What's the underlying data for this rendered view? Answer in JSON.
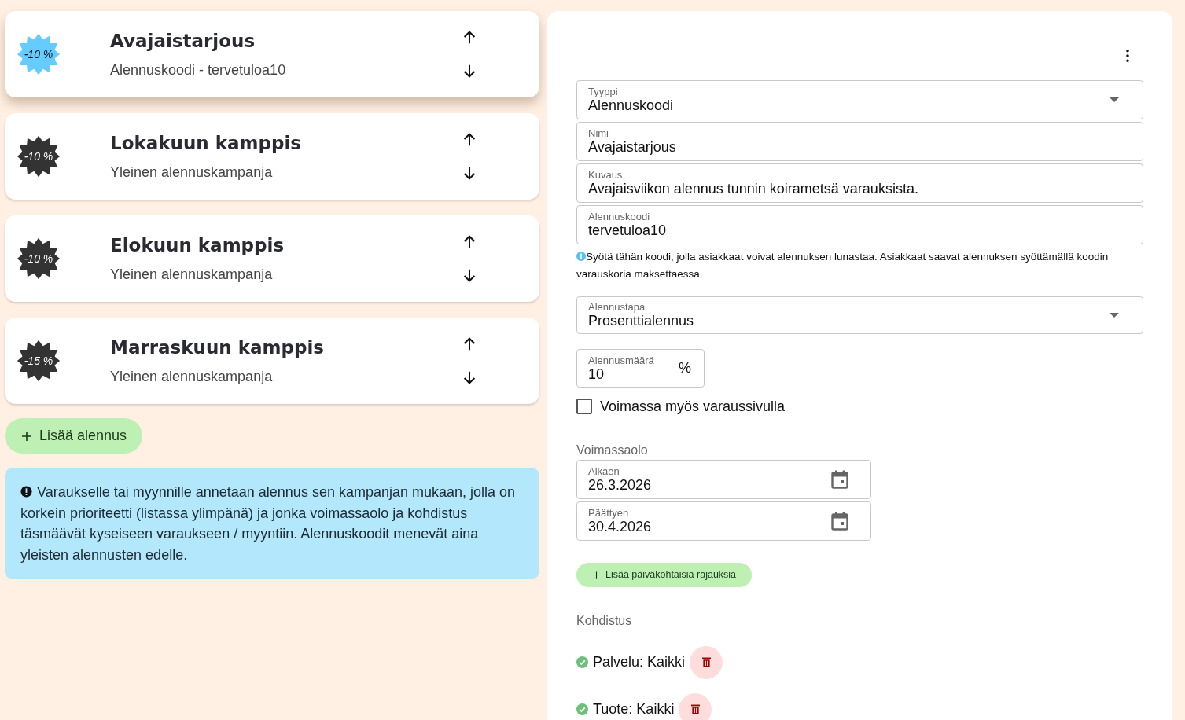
{
  "campaigns": [
    {
      "badge": "-10 %",
      "title": "Avajaistarjous",
      "subtitle": "Alennuskoodi - tervetuloa10",
      "selected": true
    },
    {
      "badge": "-10 %",
      "title": "Lokakuun kamppis",
      "subtitle": "Yleinen alennuskampanja",
      "selected": false
    },
    {
      "badge": "-10 %",
      "title": "Elokuun kamppis",
      "subtitle": "Yleinen alennuskampanja",
      "selected": false
    },
    {
      "badge": "-15 %",
      "title": "Marraskuun kamppis",
      "subtitle": "Yleinen alennuskampanja",
      "selected": false
    }
  ],
  "add_button": "Lisää alennus",
  "info": "Varaukselle tai myynnille annetaan alennus sen kampanjan mukaan, jolla on korkein prioriteetti (listassa ylimpänä) ja jonka voimassaolo ja kohdistus täsmäävät kyseiseen varaukseen / myyntiin. Alennuskoodit menevät aina yleisten alennusten edelle.",
  "form": {
    "fields": [
      {
        "kind": "select",
        "label": "Tyyppi",
        "value": "Alennuskoodi"
      },
      {
        "kind": "text",
        "label": "Nimi",
        "value": "Avajaistarjous"
      },
      {
        "kind": "text",
        "label": "Kuvaus",
        "value": "Avajaisviikon alennus tunnin koirametsä varauksista."
      },
      {
        "kind": "text",
        "label": "Alennuskoodi",
        "value": "tervetuloa10"
      }
    ],
    "help": "Syötä tähän koodi, jolla asiakkaat voivat alennuksen lunastaa. Asiakkaat saavat alennuksen syöttämällä koodin varauskoria maksettaessa.",
    "method": {
      "kind": "select",
      "label": "Alennustapa",
      "value": "Prosenttialennus"
    },
    "amount": {
      "label": "Alennusmäärä",
      "value": "10",
      "unit": "%"
    },
    "checkbox": {
      "label": "Voimassa myös varaussivulla",
      "checked": false
    },
    "validity_heading": "Voimassaolo",
    "dates": [
      {
        "label": "Alkaen",
        "value": "26.3.2026"
      },
      {
        "label": "Päättyen",
        "value": "30.4.2026"
      }
    ],
    "day_limits_button": "Lisää päiväkohtaisia rajauksia",
    "targeting_heading": "Kohdistus",
    "targets": [
      {
        "text": "Palvelu: Kaikki"
      },
      {
        "text": "Tuote: Kaikki"
      }
    ]
  }
}
